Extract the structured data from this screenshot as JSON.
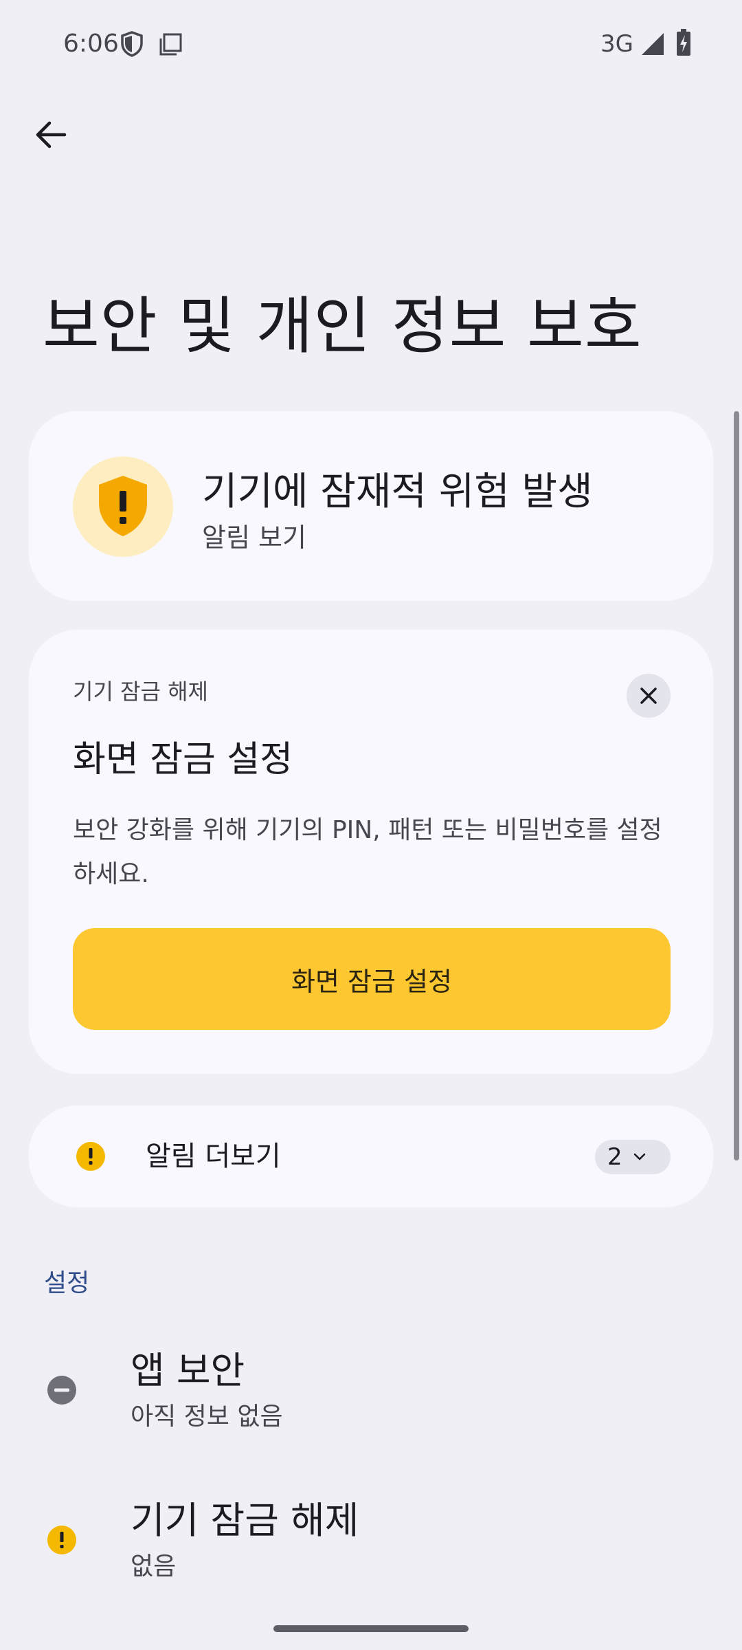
{
  "status_bar": {
    "time": "6:06",
    "network": "3G",
    "icons": [
      "shield-icon",
      "screen-icon",
      "signal-icon",
      "battery-charging-icon"
    ]
  },
  "header": {
    "back_icon": "arrow-back-icon",
    "title": "보안 및 개인 정보 보호"
  },
  "risk_card": {
    "icon": "warning-shield-icon",
    "title": "기기에 잠재적 위험 발생",
    "subtitle": "알림 보기"
  },
  "lock_card": {
    "eyebrow": "기기 잠금 해제",
    "title": "화면 잠금 설정",
    "body": "보안 강화를 위해 기기의 PIN, 패턴 또는 비밀번호를 설정하세요.",
    "button_label": "화면 잠금 설정",
    "dismiss_icon": "close-icon"
  },
  "more_alerts": {
    "label": "알림 더보기",
    "count": "2",
    "icon": "warning-icon"
  },
  "settings": {
    "header": "설정",
    "items": [
      {
        "title": "앱 보안",
        "subtitle": "아직 정보 없음",
        "icon": "minus-circle-icon"
      },
      {
        "title": "기기 잠금 해제",
        "subtitle": "없음",
        "icon": "warning-icon"
      }
    ]
  },
  "colors": {
    "background": "#efeff5",
    "card": "#f8f8fe",
    "accent_yellow": "#fdc731",
    "warning_orange": "#f5a900",
    "section_blue": "#2f4c8a"
  }
}
